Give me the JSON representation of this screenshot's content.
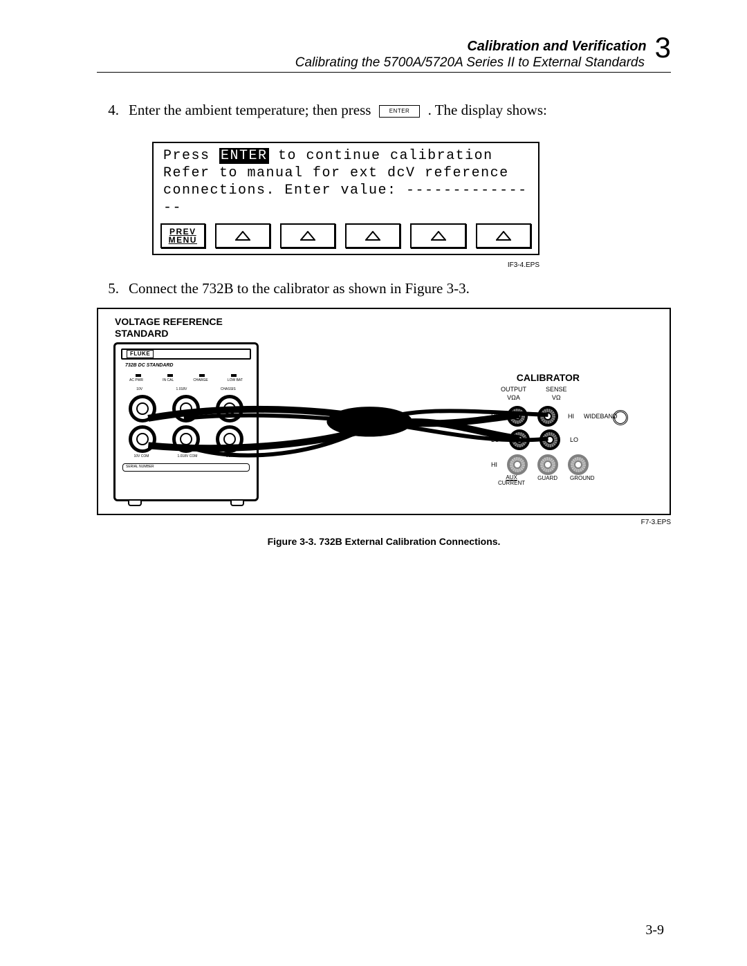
{
  "header": {
    "section_title": "Calibration and Verification",
    "subtitle": "Calibrating the 5700A/5720A Series II to External Standards",
    "chapter_number": "3"
  },
  "steps": {
    "s4": {
      "num": "4.",
      "text_before": "Enter the ambient temperature; then press",
      "key_label": "ENTER",
      "text_after": ". The display shows:"
    },
    "s5": {
      "num": "5.",
      "text": "Connect the 732B to the calibrator as shown in Figure 3-3."
    }
  },
  "display": {
    "line1_pre": "Press ",
    "line1_hl": "ENTER",
    "line1_post": " to continue calibration",
    "line2": "Refer to manual for ext dcV reference",
    "line3": "connections. Enter value: ---------------",
    "prev_menu_l1": "PREV",
    "prev_menu_l2": "MENU",
    "eps": "IF3-4.EPS"
  },
  "figure": {
    "vrs_l1": "VOLTAGE REFERENCE",
    "vrs_l2": "STANDARD",
    "calibrator": "CALIBRATOR",
    "fluke": "FLUKE",
    "device_caption": "732B DC STANDARD",
    "led_labels": [
      "AC PWR",
      "IN CAL",
      "CHARGE",
      "LOW BAT"
    ],
    "term_top_labels": [
      "10V",
      "1.018V",
      "CHASSIS"
    ],
    "term_bot_labels": [
      "10V COM",
      "1.018V COM",
      "GUARD"
    ],
    "serial": "SERIAL NUMBER",
    "cal_cols": {
      "output": "OUTPUT",
      "sense": "SENSE",
      "output_unit": "VΩA",
      "sense_unit": "VΩ"
    },
    "hi": "HI",
    "lo": "LO",
    "wideband": "WIDEBAND",
    "aux_current_l1": "AUX",
    "aux_current_l2": "CURRENT",
    "guard": "GUARD",
    "ground": "GROUND",
    "eps": "F7-3.EPS",
    "caption": "Figure 3-3. 732B External Calibration Connections."
  },
  "page_number": "3-9"
}
